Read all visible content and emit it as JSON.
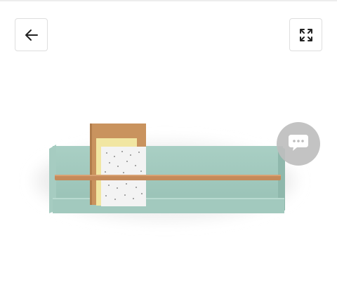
{
  "toolbar": {
    "back_icon": "arrow-left-icon",
    "expand_icon": "expand-arrows-icon"
  },
  "product_image": {
    "subject": "wall-shelf-with-books",
    "colors": {
      "shelf": "#9fc7bb",
      "rail": "#c58a5a",
      "notebook_kraft": "#c9935e",
      "notebook_yellow": "#f1e6a2",
      "notebook_dotted": "#f3f3f3"
    }
  },
  "chat": {
    "icon": "chat-bubble-icon",
    "color": "#bdbdbd"
  }
}
